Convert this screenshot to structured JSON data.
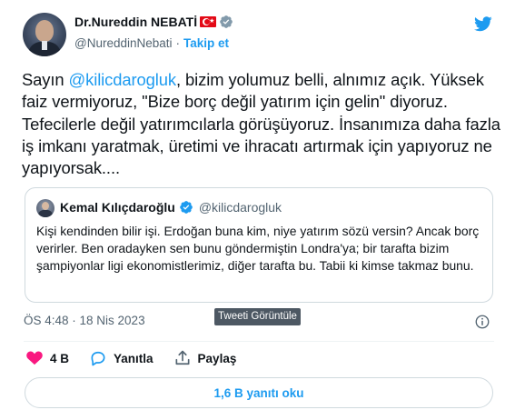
{
  "tweet": {
    "author": {
      "name": "Dr.Nureddin NEBATİ",
      "handle": "@NureddinNebati",
      "separator": "·",
      "follow_label": "Takip et"
    },
    "text_before_mention": "Sayın ",
    "mention": "@kilicdarogluk",
    "text_after_mention": ", bizim yolumuz belli, alnımız açık. Yüksek faiz vermiyoruz, \"Bize borç değil yatırım için gelin\" diyoruz. Tefecilerle değil yatırımcılarla görüşüyoruz. İnsanımıza daha fazla iş imkanı yaratmak, üretimi ve ihracatı artırmak için yapıyoruz ne yapıyorsak....",
    "quoted": {
      "name": "Kemal Kılıçdaroğlu",
      "handle": "@kilicdarogluk",
      "text": "Kişi kendinden bilir işi. Erdoğan buna kim, niye yatırım sözü versin? Ancak borç verirler. Ben oradayken sen bunu göndermiştin Londra'ya; bir tarafta bizim şampiyonlar ligi ekonomistlerimiz, diğer tarafta bu. Tabii ki kimse takmaz bunu."
    },
    "timestamp": "ÖS 4:48 · 18 Nis 2023",
    "tooltip": "Tweeti Görüntüle",
    "actions": {
      "likes": "4 B",
      "reply_label": "Yanıtla",
      "share_label": "Paylaş"
    },
    "read_replies_label": "1,6 B yanıtı oku"
  },
  "colors": {
    "accent": "#1d9bf0",
    "like": "#f91880",
    "secondary_text": "#536471",
    "border": "#cfd9de"
  },
  "icons": [
    "verified-badge-icon",
    "turkish-flag-icon",
    "twitter-bird-icon",
    "info-icon",
    "heart-icon",
    "reply-icon",
    "share-icon"
  ]
}
